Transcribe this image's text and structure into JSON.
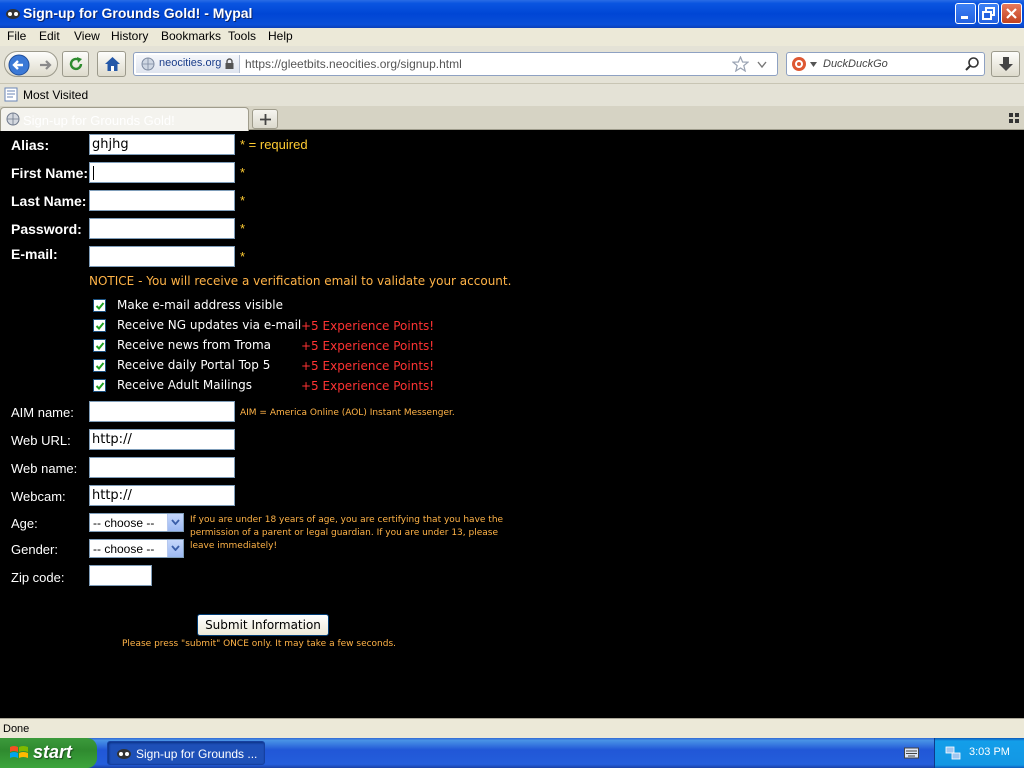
{
  "window": {
    "title": "Sign-up for Grounds Gold! - Mypal"
  },
  "menu": [
    "File",
    "Edit",
    "View",
    "History",
    "Bookmarks",
    "Tools",
    "Help"
  ],
  "navbar": {
    "site_badge": "neocities.org",
    "url": "https://gleetbits.neocities.org/signup.html",
    "search_placeholder": "DuckDuckGo"
  },
  "bookmarks": {
    "most_visited": "Most Visited"
  },
  "tab": {
    "label": "Sign-up for Grounds Gold!"
  },
  "form": {
    "alias_label": "Alias:",
    "alias_value": "ghjhg",
    "required_note": "* = required",
    "first_name_label": "First Name:",
    "last_name_label": "Last Name:",
    "password_label": "Password:",
    "email_label": "E-mail:",
    "star": "*",
    "notice": "NOTICE - You will receive a verification email to validate your account.",
    "checkboxes": [
      {
        "label": "Make e-mail address visible",
        "checked": true,
        "xp": ""
      },
      {
        "label": "Receive NG updates via e-mail",
        "checked": true,
        "xp": "+5  Experience Points!"
      },
      {
        "label": "Receive news from Troma",
        "checked": true,
        "xp": "+5  Experience Points!"
      },
      {
        "label": "Receive daily Portal Top 5",
        "checked": true,
        "xp": "+5  Experience Points!"
      },
      {
        "label": "Receive Adult Mailings",
        "checked": true,
        "xp": "+5  Experience Points!"
      }
    ],
    "aim_label": "AIM name:",
    "aim_note": "AIM = America Online (AOL) Instant Messenger.",
    "web_url_label": "Web URL:",
    "web_url_value": "http://",
    "web_name_label": "Web name:",
    "webcam_label": "Webcam:",
    "webcam_value": "http://",
    "age_label": "Age:",
    "age_value": "-- choose --",
    "gender_label": "Gender:",
    "gender_value": "-- choose --",
    "age_note_1": "If you are under 18 years of age, you are certifying that you have the",
    "age_note_2": "permission of a parent or legal guardian. If you are under 13, please",
    "age_note_3": "leave immediately!",
    "zip_label": "Zip code:",
    "submit_label": "Submit Information",
    "submit_note": "Please press \"submit\" ONCE only. It may take a few seconds."
  },
  "status": {
    "text": "Done"
  },
  "taskbar": {
    "start": "start",
    "task": "Sign-up for Grounds ...",
    "clock": "3:03 PM"
  }
}
